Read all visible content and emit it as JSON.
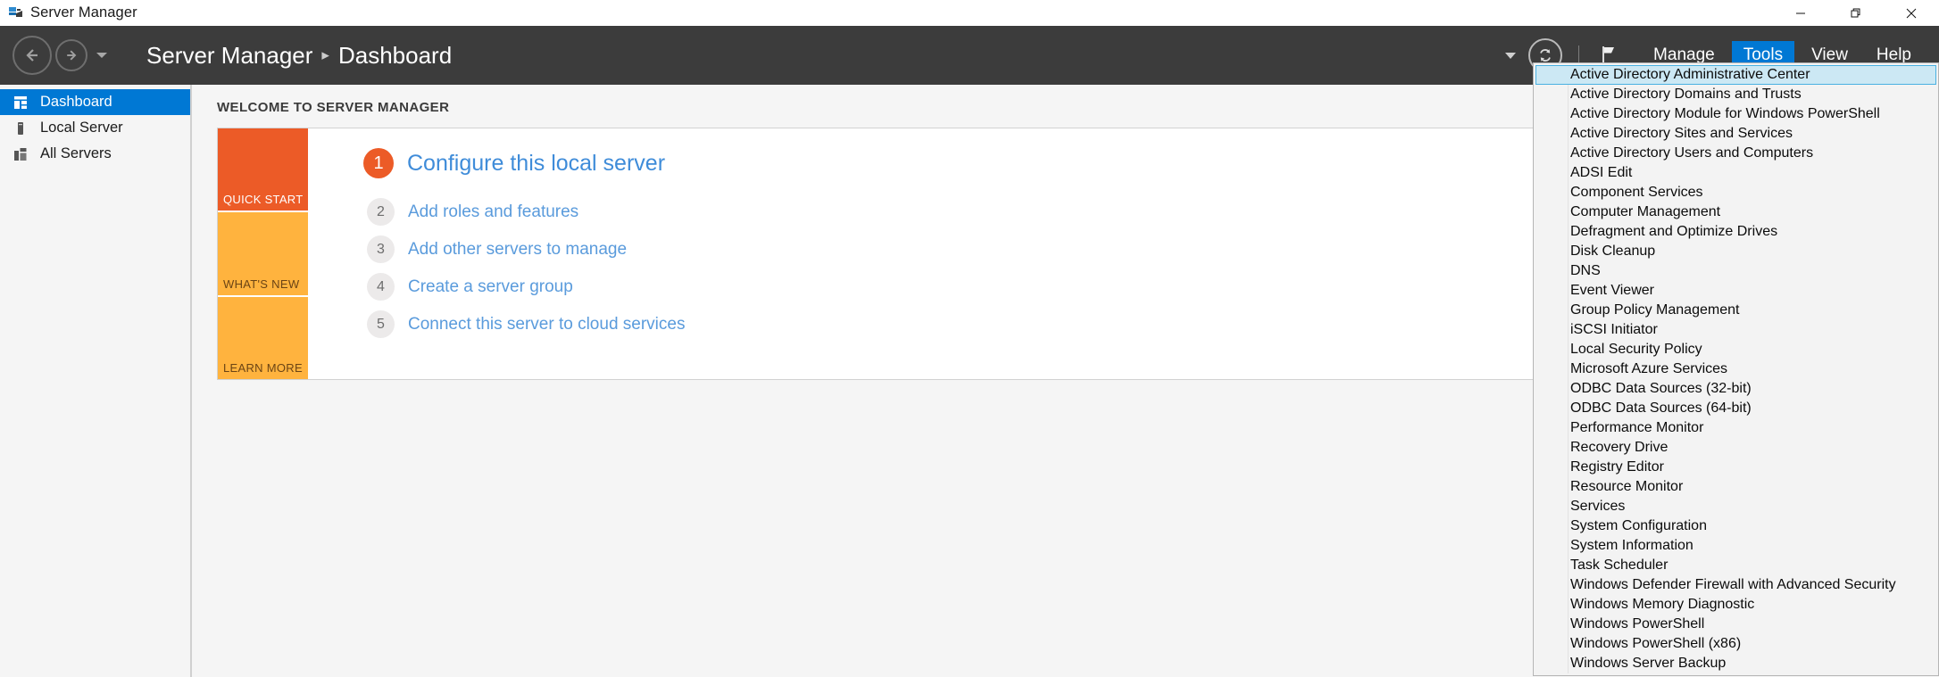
{
  "window": {
    "title": "Server Manager",
    "app_icon": "server-manager-icon",
    "controls": {
      "minimize": "minimize-icon",
      "restore": "restore-icon",
      "close": "close-icon"
    }
  },
  "commandbar": {
    "back": "back-arrow-icon",
    "forward": "forward-arrow-icon",
    "history_caret": "chevron-down-icon",
    "breadcrumb": {
      "root": "Server Manager",
      "separator": "▸",
      "leaf": "Dashboard"
    },
    "refresh_caret": "chevron-down-icon",
    "refresh": "refresh-icon",
    "notifications": "flag-icon",
    "menus": [
      {
        "label": "Manage",
        "active": false
      },
      {
        "label": "Tools",
        "active": true
      },
      {
        "label": "View",
        "active": false
      },
      {
        "label": "Help",
        "active": false
      }
    ]
  },
  "sidebar": {
    "items": [
      {
        "label": "Dashboard",
        "icon": "dashboard-grid-icon",
        "selected": true
      },
      {
        "label": "Local Server",
        "icon": "server-icon",
        "selected": false
      },
      {
        "label": "All Servers",
        "icon": "all-servers-icon",
        "selected": false
      }
    ]
  },
  "main": {
    "welcome_heading": "WELCOME TO SERVER MANAGER",
    "tiles": [
      {
        "label": "QUICK START",
        "style": "quick"
      },
      {
        "label": "WHAT'S NEW",
        "style": "whatsnew"
      },
      {
        "label": "LEARN MORE",
        "style": "learn"
      }
    ],
    "steps": [
      {
        "number": "1",
        "label": "Configure this local server",
        "primary": true
      },
      {
        "number": "2",
        "label": "Add roles and features",
        "primary": false
      },
      {
        "number": "3",
        "label": "Add other servers to manage",
        "primary": false
      },
      {
        "number": "4",
        "label": "Create a server group",
        "primary": false
      },
      {
        "number": "5",
        "label": "Connect this server to cloud services",
        "primary": false
      }
    ]
  },
  "tools_menu": {
    "items": [
      {
        "label": "Active Directory Administrative Center",
        "highlighted": true
      },
      {
        "label": "Active Directory Domains and Trusts",
        "highlighted": false
      },
      {
        "label": "Active Directory Module for Windows PowerShell",
        "highlighted": false
      },
      {
        "label": "Active Directory Sites and Services",
        "highlighted": false
      },
      {
        "label": "Active Directory Users and Computers",
        "highlighted": false
      },
      {
        "label": "ADSI Edit",
        "highlighted": false
      },
      {
        "label": "Component Services",
        "highlighted": false
      },
      {
        "label": "Computer Management",
        "highlighted": false
      },
      {
        "label": "Defragment and Optimize Drives",
        "highlighted": false
      },
      {
        "label": "Disk Cleanup",
        "highlighted": false
      },
      {
        "label": "DNS",
        "highlighted": false
      },
      {
        "label": "Event Viewer",
        "highlighted": false
      },
      {
        "label": "Group Policy Management",
        "highlighted": false
      },
      {
        "label": "iSCSI Initiator",
        "highlighted": false
      },
      {
        "label": "Local Security Policy",
        "highlighted": false
      },
      {
        "label": "Microsoft Azure Services",
        "highlighted": false
      },
      {
        "label": "ODBC Data Sources (32-bit)",
        "highlighted": false
      },
      {
        "label": "ODBC Data Sources (64-bit)",
        "highlighted": false
      },
      {
        "label": "Performance Monitor",
        "highlighted": false
      },
      {
        "label": "Recovery Drive",
        "highlighted": false
      },
      {
        "label": "Registry Editor",
        "highlighted": false
      },
      {
        "label": "Resource Monitor",
        "highlighted": false
      },
      {
        "label": "Services",
        "highlighted": false
      },
      {
        "label": "System Configuration",
        "highlighted": false
      },
      {
        "label": "System Information",
        "highlighted": false
      },
      {
        "label": "Task Scheduler",
        "highlighted": false
      },
      {
        "label": "Windows Defender Firewall with Advanced Security",
        "highlighted": false
      },
      {
        "label": "Windows Memory Diagnostic",
        "highlighted": false
      },
      {
        "label": "Windows PowerShell",
        "highlighted": false
      },
      {
        "label": "Windows PowerShell (x86)",
        "highlighted": false
      },
      {
        "label": "Windows Server Backup",
        "highlighted": false
      }
    ]
  },
  "colors": {
    "accent_blue": "#0078d4",
    "command_bar": "#3c3c3c",
    "tile_orange": "#ec5b27",
    "tile_amber": "#ffb33e",
    "link_blue": "#3f8cd9",
    "menu_highlight": "#cce8f4"
  }
}
